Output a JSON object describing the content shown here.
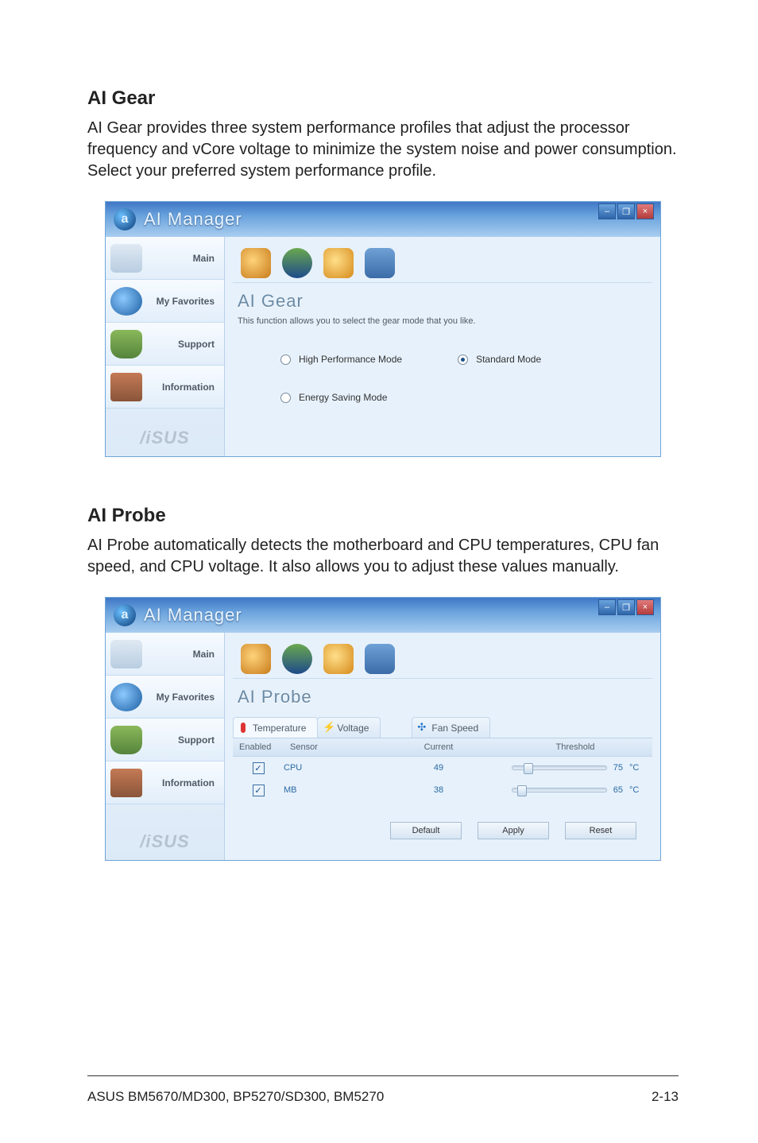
{
  "sections": {
    "aiGear": {
      "title": "AI Gear",
      "desc": "AI Gear provides three system performance profiles that adjust the processor frequency and vCore voltage to minimize the system noise and power consumption. Select your preferred system performance profile."
    },
    "aiProbe": {
      "title": "AI Probe",
      "desc": "AI Probe automatically detects the motherboard and CPU temperatures, CPU fan speed, and CPU voltage. It also allows you to adjust these values manually."
    }
  },
  "app": {
    "title": "AI Manager",
    "sidebar": {
      "main": "Main",
      "favorites": "My Favorites",
      "support": "Support",
      "information": "Information",
      "brand": "/iSUS"
    },
    "window": {
      "min": "–",
      "max": "❐",
      "close": "×"
    }
  },
  "gear": {
    "panelTitle": "AI Gear",
    "funcText": "This function allows you to select the gear mode that you like.",
    "options": {
      "high": "High Performance Mode",
      "standard": "Standard Mode",
      "energy": "Energy Saving Mode"
    }
  },
  "probe": {
    "panelTitle": "AI Probe",
    "tabs": {
      "temperature": "Temperature",
      "voltage": "Voltage",
      "fanSpeed": "Fan Speed"
    },
    "columns": {
      "enabled": "Enabled",
      "sensor": "Sensor",
      "current": "Current",
      "threshold": "Threshold"
    },
    "rows": [
      {
        "sensor": "CPU",
        "current": "49",
        "threshold": "75",
        "unit": "°C",
        "thumbLeft": 14
      },
      {
        "sensor": "MB",
        "current": "38",
        "threshold": "65",
        "unit": "°C",
        "thumbLeft": 6
      }
    ],
    "buttons": {
      "default": "Default",
      "apply": "Apply",
      "reset": "Reset"
    }
  },
  "footer": {
    "left": "ASUS BM5670/MD300, BP5270/SD300, BM5270",
    "right": "2-13"
  }
}
